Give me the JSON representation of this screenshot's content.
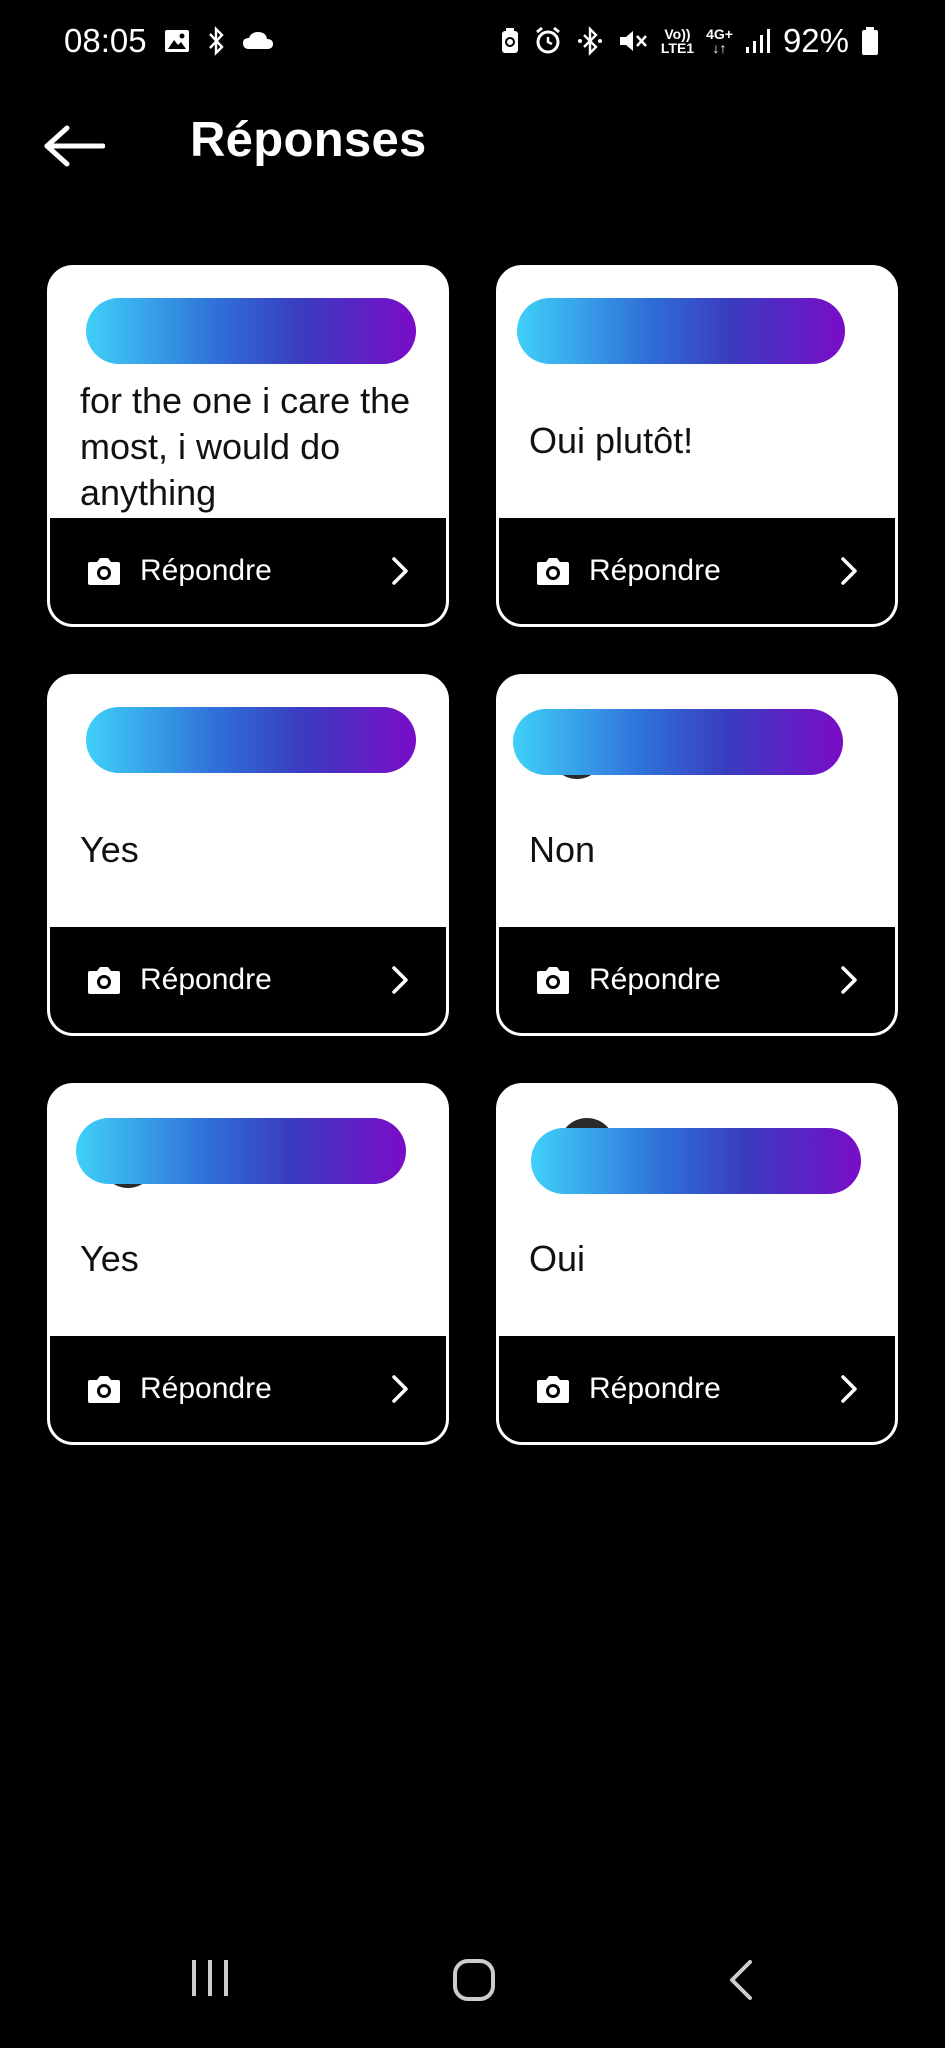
{
  "status_bar": {
    "time": "08:05",
    "network_top": "Vo))",
    "network_bottom": "LTE1",
    "network2_top": "4G+",
    "network2_bottom": "↓↑",
    "battery": "92%"
  },
  "header": {
    "title": "Réponses"
  },
  "cards": [
    {
      "text": "for the one i care the most, i would do anything",
      "action": "Répondre"
    },
    {
      "text": "Oui plutôt!",
      "action": "Répondre"
    },
    {
      "text": "Yes",
      "action": "Répondre"
    },
    {
      "text": "Non",
      "action": "Répondre"
    },
    {
      "text": "Yes",
      "action": "Répondre"
    },
    {
      "text": "Oui",
      "action": "Répondre"
    }
  ],
  "icons": {
    "back": "arrow-left-icon",
    "camera": "camera-icon",
    "chevron": "chevron-right-icon",
    "nav_recents": "recents-icon",
    "nav_home": "home-icon",
    "nav_back": "nav-back-icon"
  },
  "colors": {
    "background": "#000000",
    "card": "#ffffff",
    "gradient_start": "#3fd0f8",
    "gradient_end": "#7a0cc8"
  }
}
